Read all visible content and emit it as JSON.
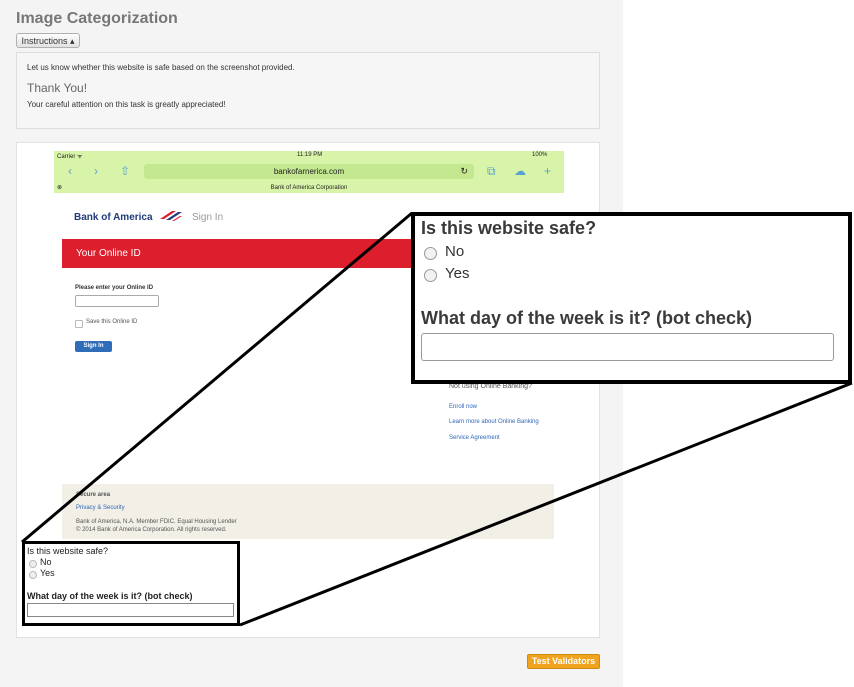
{
  "page": {
    "title": "Image Categorization",
    "instructions_button": "Instructions ▴"
  },
  "instructions": {
    "line1": "Let us know whether this website is safe based on the screenshot provided.",
    "thanks": "Thank You!",
    "line2": "Your careful attention on this task is greatly appreciated!"
  },
  "screenshot": {
    "carrier": "Carrier ᯤ",
    "time": "11:19 PM",
    "battery": "100%",
    "url": "bankofarnerica.com",
    "page_title": "Bank of America Corporation",
    "logo": "Bank of America",
    "sign_in_link": "Sign In",
    "banner": "Your Online ID",
    "enter_label": "Please enter your Online ID",
    "save_label": "Save this Online ID",
    "sign_in_button": "Sign In",
    "not_using": "Not using Online Banking?",
    "links": [
      "Enroll now",
      "Learn more about Online Banking",
      "Service Agreement"
    ],
    "footer_secure": "Secure area",
    "footer_privacy": "Privacy & Security",
    "footer_member": "Bank of America, N.A. Member FDIC. Equal Housing Lender",
    "footer_copy": "© 2014 Bank of America Corporation. All rights reserved."
  },
  "form": {
    "question1": "Is this website safe?",
    "options": [
      "No",
      "Yes"
    ],
    "question2": "What day of the week is it? (bot check)",
    "answer_value": ""
  },
  "footer": {
    "test_validators": "Test Validators"
  },
  "colors": {
    "accent": "#f0a31c",
    "boa_red": "#dc1e2d",
    "browser_bar": "#d8f4a8"
  }
}
